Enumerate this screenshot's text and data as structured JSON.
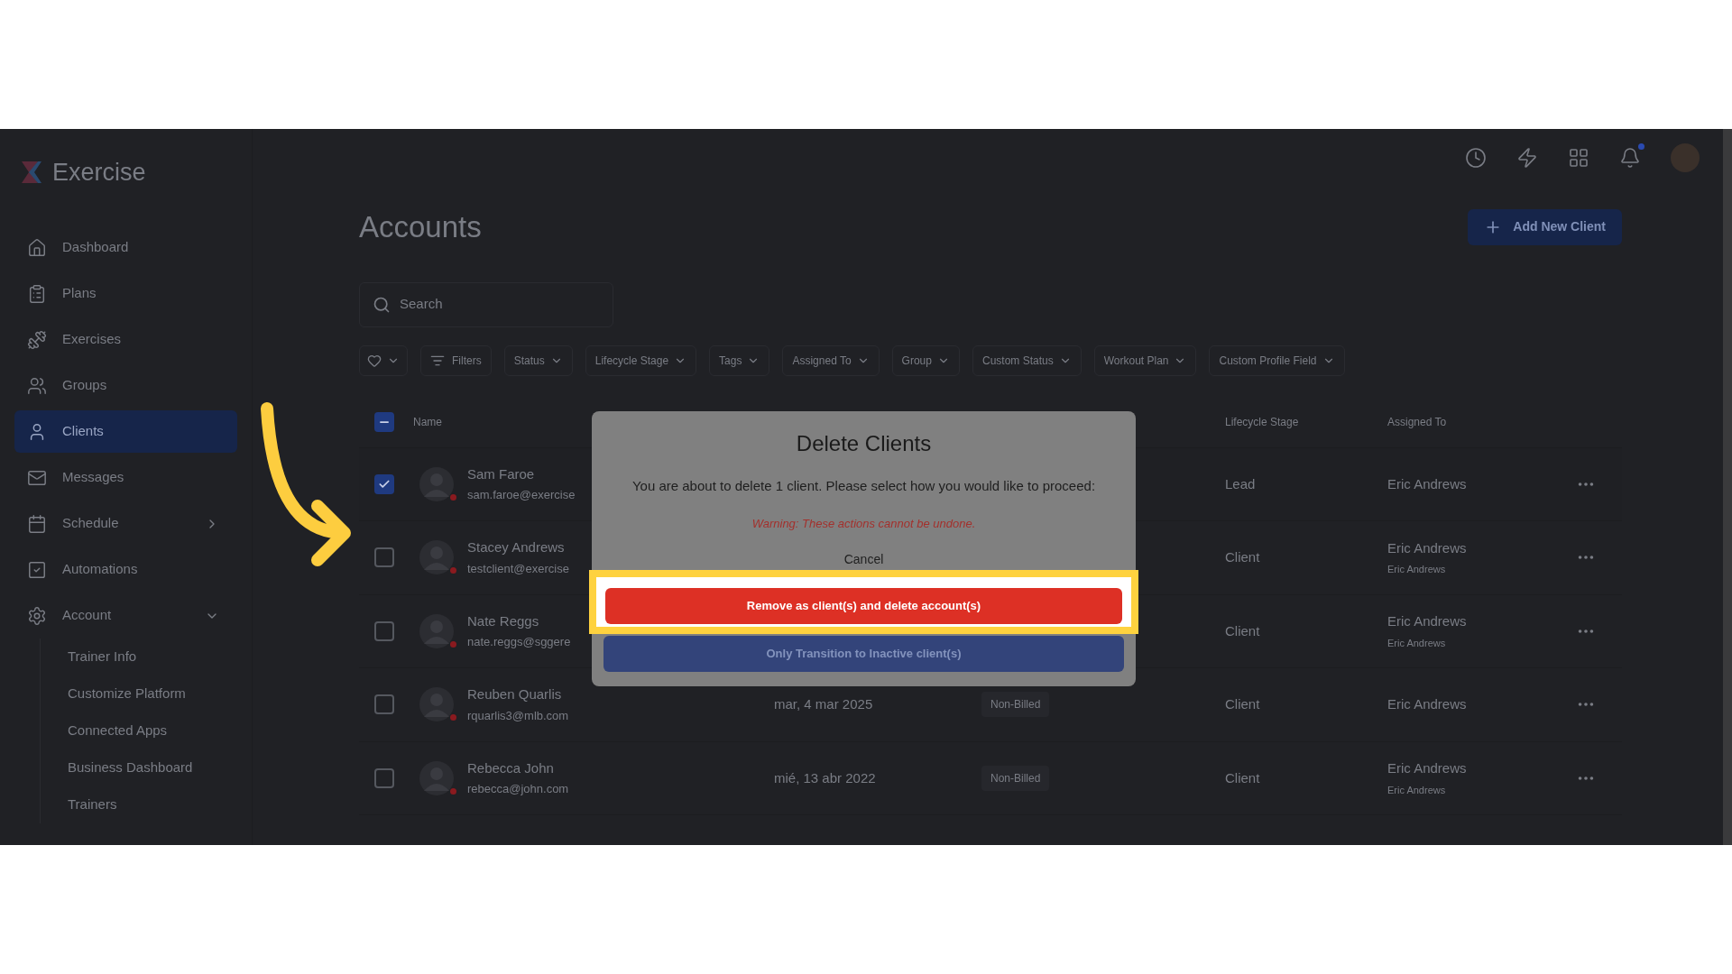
{
  "sidebar": {
    "brand": "Exercise",
    "items": [
      {
        "label": "Dashboard",
        "selected": false
      },
      {
        "label": "Plans",
        "selected": false
      },
      {
        "label": "Exercises",
        "selected": false
      },
      {
        "label": "Groups",
        "selected": false
      },
      {
        "label": "Clients",
        "selected": true
      },
      {
        "label": "Messages",
        "selected": false
      },
      {
        "label": "Schedule",
        "selected": false,
        "expanded": false
      },
      {
        "label": "Automations",
        "selected": false
      },
      {
        "label": "Account",
        "selected": false,
        "expanded": true,
        "children": [
          {
            "label": "Trainer Info",
            "selected": false
          },
          {
            "label": "Customize Platform",
            "selected": false
          },
          {
            "label": "Connected Apps",
            "selected": false
          },
          {
            "label": "Business Dashboard",
            "selected": false
          },
          {
            "label": "Trainers",
            "selected": false
          }
        ]
      }
    ]
  },
  "topbar": {
    "unread_notifications": true
  },
  "page": {
    "title": "Accounts",
    "add_button": "Add New Client",
    "search": {
      "placeholder": "Search"
    },
    "filters": [
      {
        "kind": "favorites"
      },
      {
        "kind": "filters",
        "label": "Filters"
      },
      {
        "kind": "dropdown",
        "label": "Status"
      },
      {
        "kind": "dropdown",
        "label": "Lifecycle Stage"
      },
      {
        "kind": "dropdown",
        "label": "Tags"
      },
      {
        "kind": "dropdown",
        "label": "Assigned To"
      },
      {
        "kind": "dropdown",
        "label": "Group"
      },
      {
        "kind": "dropdown",
        "label": "Custom Status"
      },
      {
        "kind": "dropdown",
        "label": "Workout Plan"
      },
      {
        "kind": "dropdown",
        "label": "Custom Profile Field"
      }
    ]
  },
  "table": {
    "all_indeterminate": true,
    "columns": [
      {
        "label": "Name"
      },
      {
        "label": "Lifecycle Stage"
      },
      {
        "label": "Assigned To"
      }
    ],
    "rows": [
      {
        "checked": true,
        "name": "Sam Faroe",
        "email": "sam.faroe@exercise",
        "stage": "Lead",
        "assigned": "Eric Andrews"
      },
      {
        "checked": false,
        "name": "Stacey Andrews",
        "email": "testclient@exercise",
        "stage": "Client",
        "assigned": "Eric Andrews",
        "assigned_sub": "Eric Andrews"
      },
      {
        "checked": false,
        "name": "Nate Reggs",
        "email": "nate.reggs@sggere",
        "stage": "Client",
        "assigned": "Eric Andrews",
        "assigned_sub": "Eric Andrews"
      },
      {
        "checked": false,
        "name": "Reuben Quarlis",
        "email": "rquarlis3@mlb.com",
        "date": "mar, 4 mar 2025",
        "billing": "Non-Billed",
        "stage": "Client",
        "assigned": "Eric Andrews"
      },
      {
        "checked": false,
        "name": "Rebecca John",
        "email": "rebecca@john.com",
        "date": "mié, 13 abr 2022",
        "billing": "Non-Billed",
        "stage": "Client",
        "assigned": "Eric Andrews",
        "assigned_sub": "Eric Andrews"
      }
    ]
  },
  "modal": {
    "title": "Delete Clients",
    "message": "You are about to delete 1 client. Please select how you would like to proceed:",
    "warning": "Warning: These actions cannot be undone.",
    "cancel": "Cancel",
    "buttons": [
      {
        "label": "Remove as client(s) and delete account(s)",
        "kind": "danger",
        "highlighted": true
      },
      {
        "label": "Only Transition to Inactive client(s)",
        "kind": "primary",
        "highlighted": false
      }
    ]
  }
}
